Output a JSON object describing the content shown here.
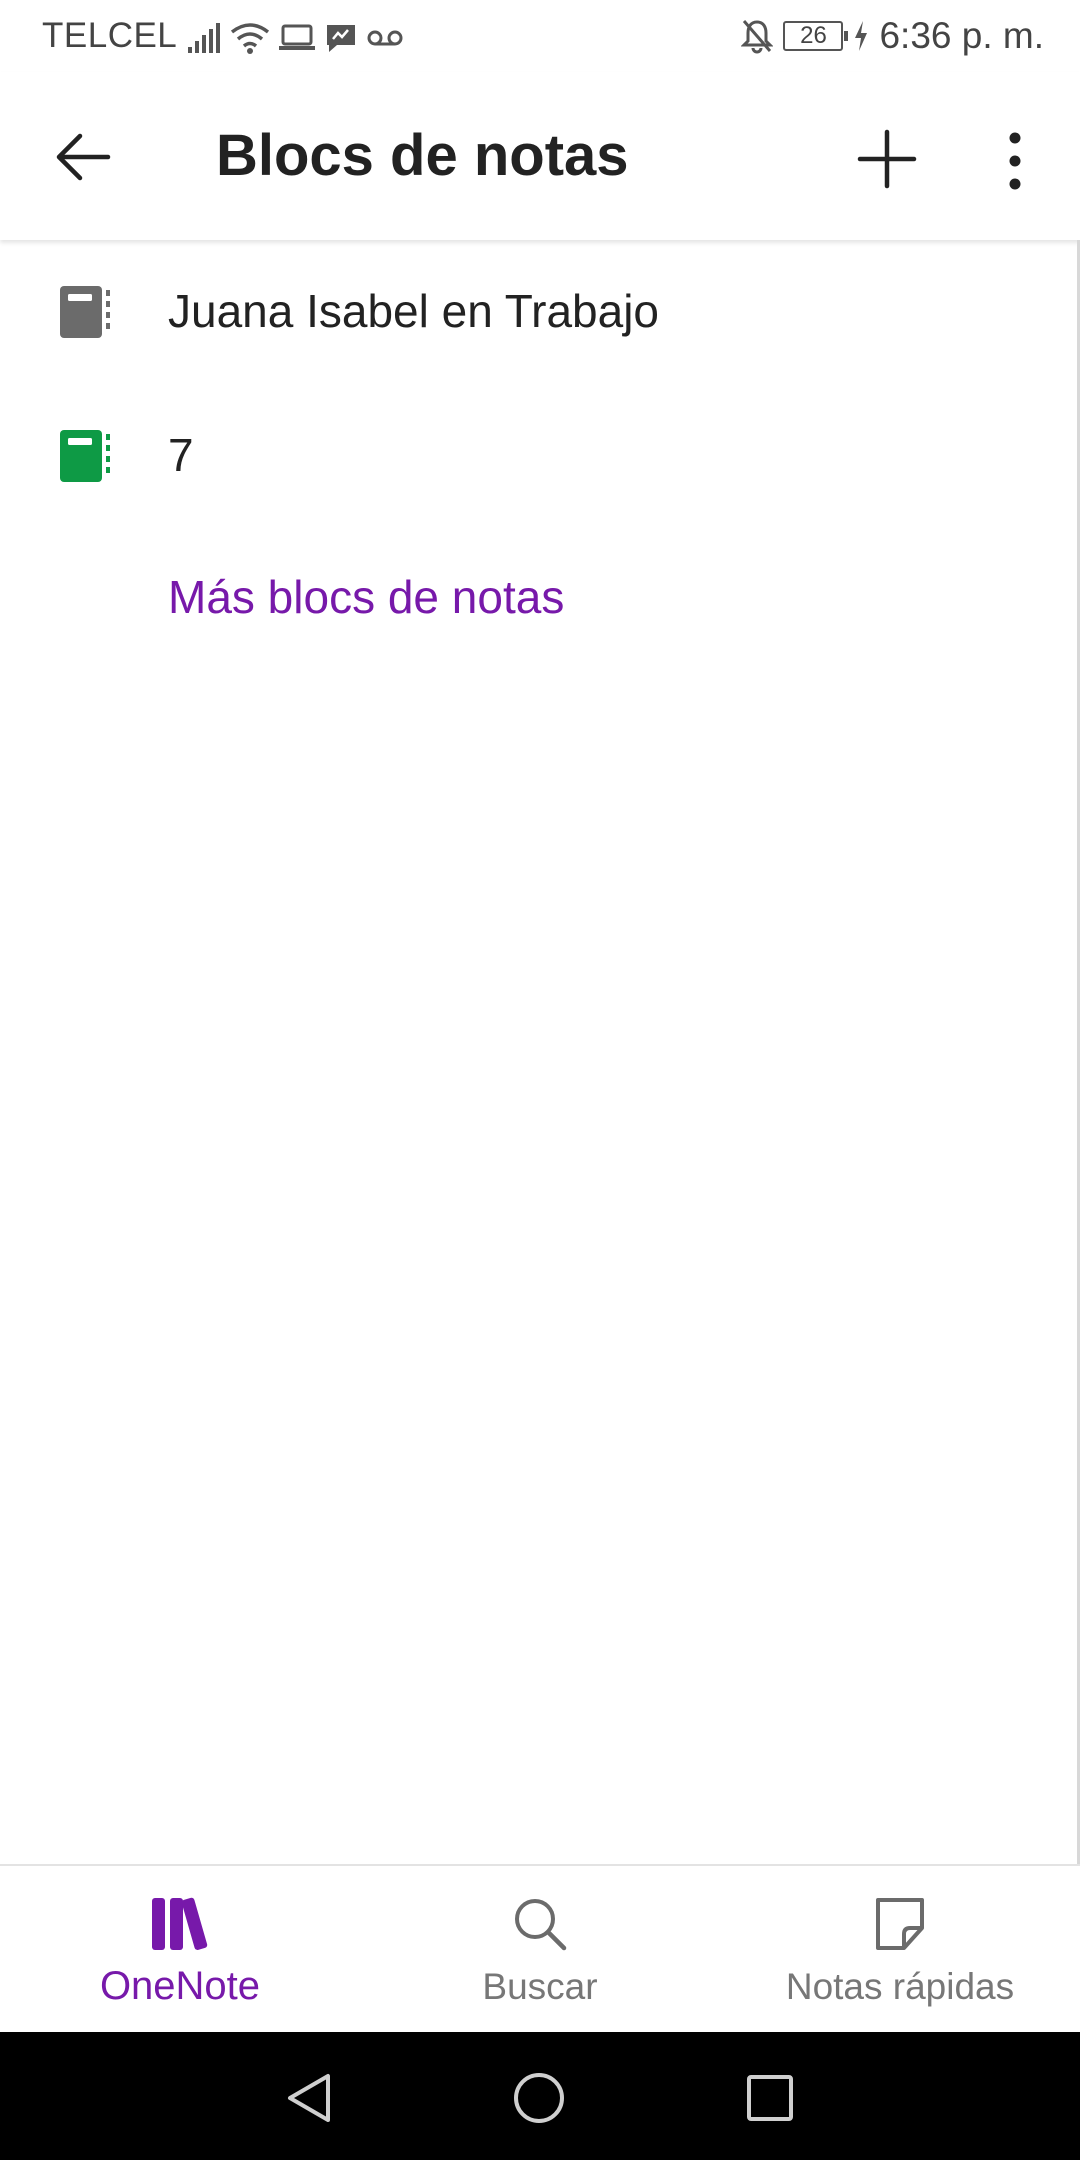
{
  "status_bar": {
    "carrier": "TELCEL",
    "battery_level": "26",
    "time": "6:36 p. m."
  },
  "app_bar": {
    "title": "Blocs de notas"
  },
  "notebooks": [
    {
      "label": "Juana Isabel en Trabajo",
      "icon_color": "#6b6b6b"
    },
    {
      "label": "7",
      "icon_color": "#0e9a45"
    }
  ],
  "more_link": "Más blocs de notas",
  "bottom_nav": {
    "items": [
      {
        "label": "OneNote",
        "active": true
      },
      {
        "label": "Buscar",
        "active": false
      },
      {
        "label": "Notas rápidas",
        "active": false
      }
    ]
  },
  "colors": {
    "accent": "#7719aa",
    "text": "#212121",
    "secondary": "#777777"
  },
  "icons": {
    "back": "arrow-left-icon",
    "add": "plus-icon",
    "more": "vertical-dots-icon",
    "onenote": "library-books-icon",
    "search": "search-icon",
    "sticky_notes": "sticky-note-icon"
  }
}
